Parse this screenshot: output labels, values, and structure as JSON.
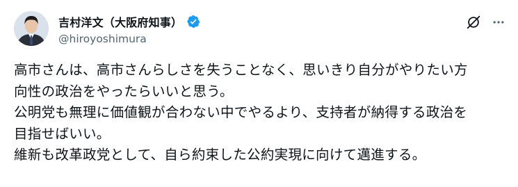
{
  "author": {
    "display_name": "吉村洋文（大阪府知事）",
    "handle": "@hiroyoshimura"
  },
  "icons": {
    "verified": "verified-badge-icon",
    "grok": "grok-icon",
    "more": "more-options-icon"
  },
  "colors": {
    "verified": "#1d9bf0",
    "text": "#0f1419",
    "secondary": "#536471"
  },
  "post": {
    "lines": [
      "高市さんは、高市さんらしさを失うことなく、思いきり自分がやりたい方",
      "向性の政治をやったらいいと思う。",
      "公明党も無理に価値観が合わない中でやるより、支持者が納得する政治を",
      "目指せばいい。",
      "維新も改革政党として、自ら約束した公約実現に向けて邁進する。"
    ]
  }
}
